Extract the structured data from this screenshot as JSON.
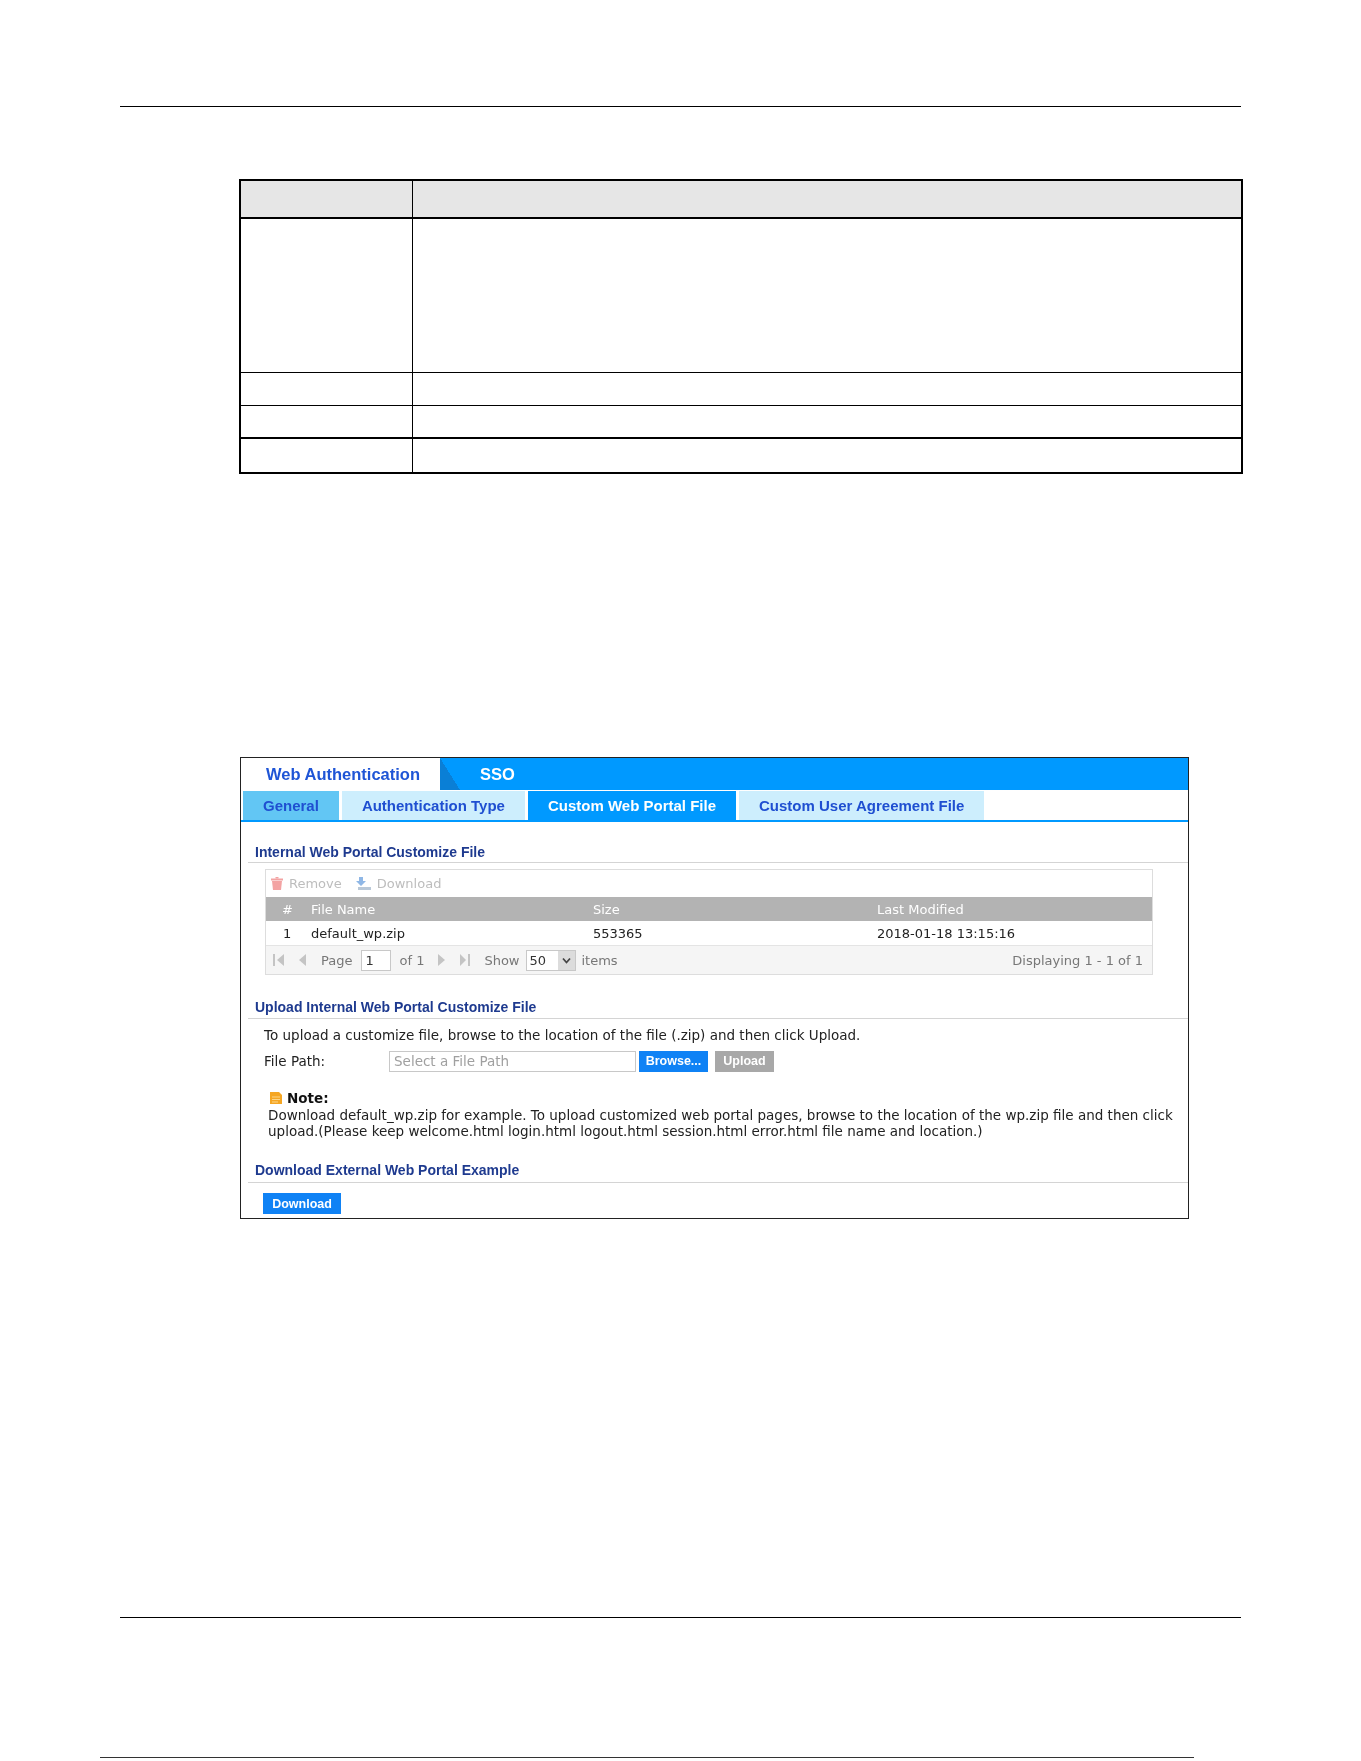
{
  "tabs": [
    {
      "label": "Web Authentication",
      "selected": true
    },
    {
      "label": "SSO",
      "selected": false
    }
  ],
  "subtabs": [
    {
      "label": "General",
      "selected": false,
      "highlighted": true
    },
    {
      "label": "Authentication Type",
      "selected": false,
      "highlighted": false
    },
    {
      "label": "Custom Web Portal File",
      "selected": true,
      "highlighted": false
    },
    {
      "label": "Custom User Agreement File",
      "selected": false,
      "highlighted": false
    }
  ],
  "file_list": {
    "title": "Internal Web Portal Customize File",
    "toolbar": [
      {
        "kind": "remove",
        "label": "Remove",
        "disabled": true
      },
      {
        "kind": "download",
        "label": "Download",
        "disabled": true
      }
    ],
    "columns": [
      "#",
      "File Name",
      "Size",
      "Last Modified"
    ],
    "rows": [
      {
        "cells": [
          "1",
          "default_wp.zip",
          "553365",
          "2018-01-18 13:15:16"
        ]
      }
    ],
    "pager": {
      "page_label": "Page",
      "page": "1",
      "page_count": "of 1",
      "show_label": "Show",
      "page_size": "50",
      "items_label": "items",
      "summary": "Displaying 1 - 1 of 1"
    }
  },
  "upload": {
    "title": "Upload Internal Web Portal Customize File",
    "instruction": "To upload a customize file, browse to the location of the file (.zip) and then click Upload.",
    "file_path": {
      "label": "File Path:",
      "placeholder": "Select a File Path"
    },
    "buttons": [
      {
        "label": "Browse...",
        "disabled": false
      },
      {
        "label": "Upload",
        "disabled": true
      }
    ],
    "note": {
      "title": "Note:",
      "text": "Download default_wp.zip for example. To upload customized web portal pages, browse to the location of the wp.zip file and then click upload.(Please keep welcome.html login.html logout.html session.html error.html file name and location.)"
    }
  },
  "example": {
    "title": "Download External Web Portal Example",
    "button": {
      "label": "Download"
    }
  }
}
